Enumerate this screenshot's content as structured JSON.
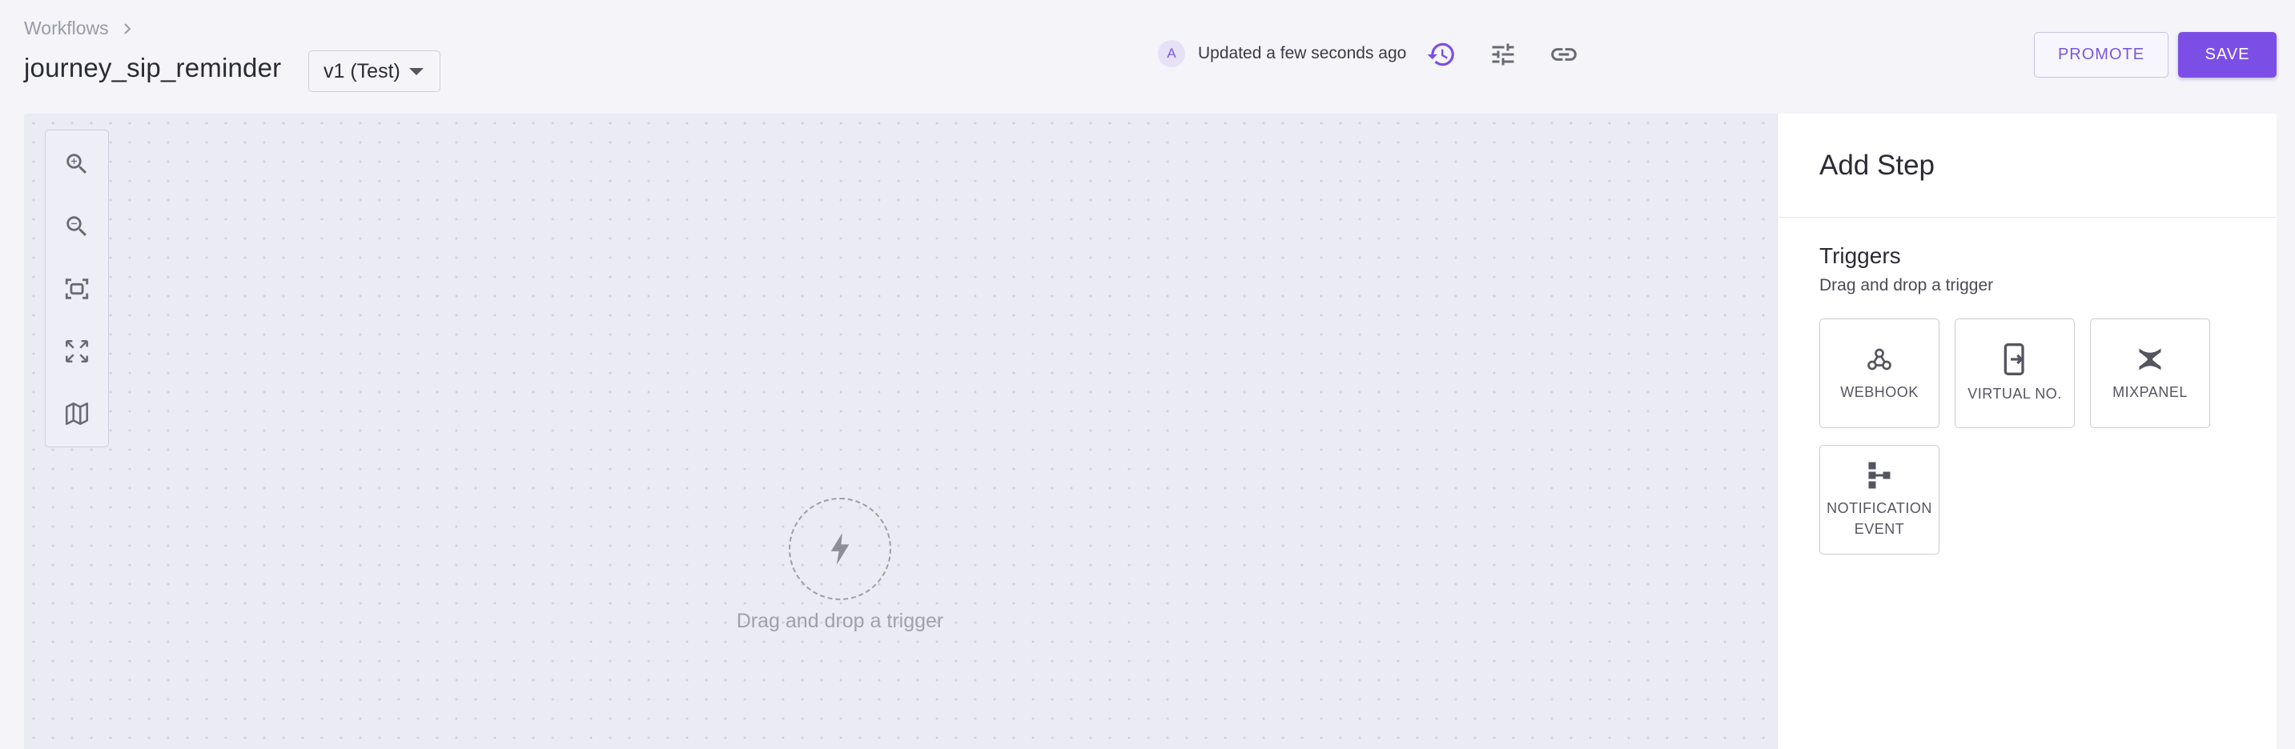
{
  "breadcrumb": {
    "root": "Workflows"
  },
  "workflow": {
    "title": "journey_sip_reminder"
  },
  "version_select": {
    "value": "v1 (Test)"
  },
  "status": {
    "avatar_initial": "A",
    "text": "Updated a few seconds ago"
  },
  "header_icons": [
    "history-icon",
    "tune-icon",
    "link-icon"
  ],
  "actions": {
    "promote": "PROMOTE",
    "save": "SAVE"
  },
  "toolbar": {
    "tools": [
      "zoom-in-icon",
      "zoom-out-icon",
      "fit-view-icon",
      "fullscreen-icon",
      "minimap-icon"
    ]
  },
  "canvas": {
    "placeholder": "Drag and drop a trigger",
    "placeholder_icon": "bolt-icon"
  },
  "panel": {
    "title": "Add Step",
    "section_title": "Triggers",
    "section_subtitle": "Drag and drop a trigger",
    "tiles": [
      {
        "label": "WEBHOOK",
        "icon": "webhook-icon"
      },
      {
        "label": "VIRTUAL NO.",
        "icon": "phone-forward-icon"
      },
      {
        "label": "MIXPANEL",
        "icon": "mixpanel-icon"
      },
      {
        "label": "NOTIFICATION EVENT",
        "icon": "event-tree-icon"
      }
    ]
  },
  "colors": {
    "accent": "#7b4fe6",
    "canvas_bg": "#ebebf3",
    "page_bg": "#f4f4f9"
  }
}
